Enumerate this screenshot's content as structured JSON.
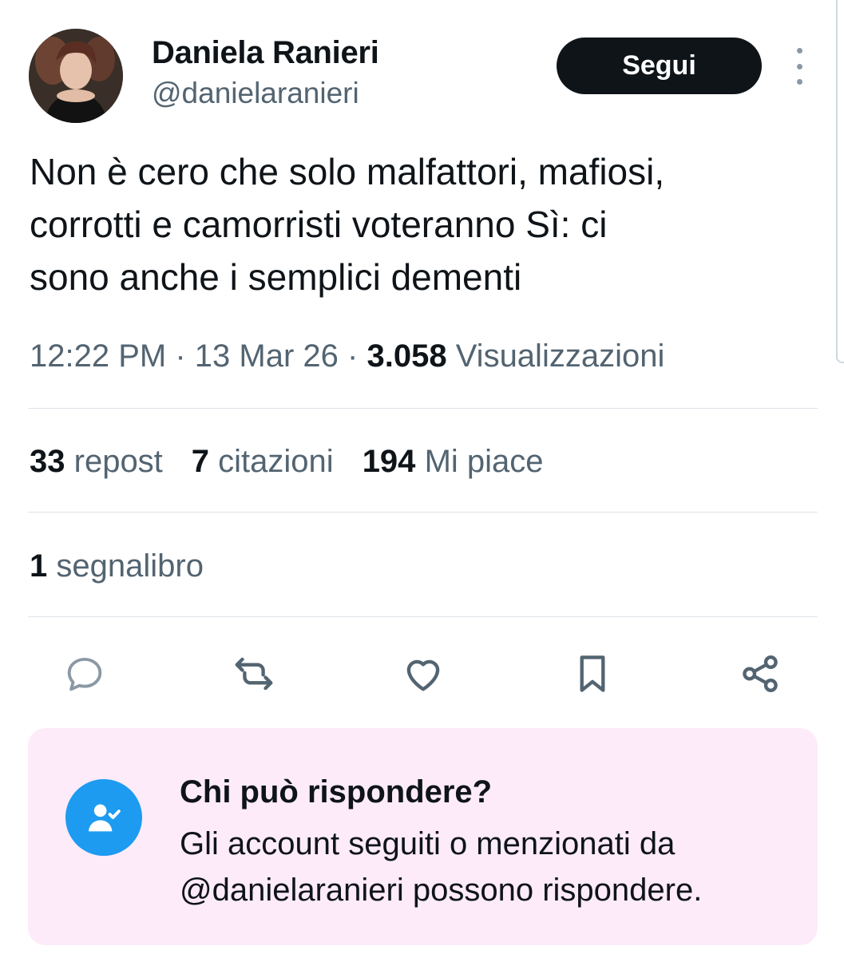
{
  "author": {
    "display_name": "Daniela Ranieri",
    "handle": "@danielaranieri"
  },
  "follow_label": "Segui",
  "tweet": {
    "lines": [
      "Non è cero che solo malfattori, mafiosi,",
      "corrotti e camorristi voteranno Sì: ci",
      "sono anche i semplici dementi"
    ]
  },
  "meta": {
    "time": "12:22 PM",
    "separator": "·",
    "date": "13 Mar 26",
    "views_count": "3.058",
    "views_label": "Visualizzazioni"
  },
  "stats": {
    "reposts_count": "33",
    "reposts_label": "repost",
    "quotes_count": "7",
    "quotes_label": "citazioni",
    "likes_count": "194",
    "likes_label": "Mi piace",
    "bookmarks_count": "1",
    "bookmarks_label": "segnalibro"
  },
  "actions": [
    "reply-icon",
    "retweet-icon",
    "like-icon",
    "bookmark-icon",
    "share-icon"
  ],
  "reply_restriction": {
    "title": "Chi può rispondere?",
    "lines": [
      "Gli account seguiti o menzionati da",
      "@danielaranieri possono rispondere."
    ],
    "icon": "person-check-icon"
  },
  "colors": {
    "primary_text": "#0f1419",
    "secondary_text": "#536471",
    "accent": "#1d9bf0",
    "reply_box_bg": "#fdebf9",
    "action_icon": "#536471"
  }
}
